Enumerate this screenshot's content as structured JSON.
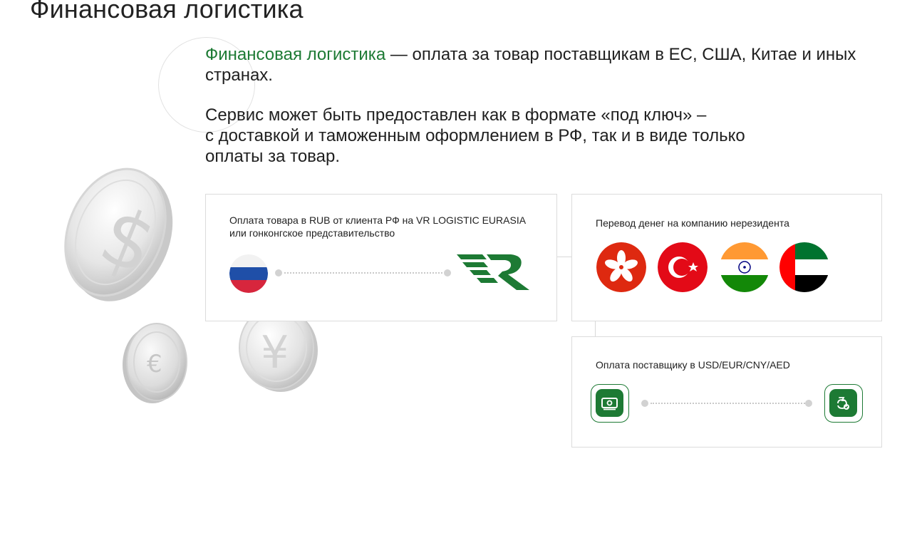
{
  "page": {
    "title": "Финансовая логистика"
  },
  "intro": {
    "highlight": "Финансовая логистика",
    "rest": " — оплата за товар поставщикам в ЕС, США, Китае и иных странах."
  },
  "description": "Сервис может быть предоставлен как в формате «под ключ» –\nс доставкой и таможенным оформлением в РФ, так и в виде только\nоплаты за товар.",
  "cards": {
    "payment_rub": {
      "text": "Оплата товара в RUB от клиента РФ на VR LOGISTIC EURASIA или гонконгское представительство"
    },
    "transfer": {
      "text": "Перевод денег на компанию нерезидента"
    },
    "supplier": {
      "text": "Оплата поставщику в USD/EUR/CNY/AED"
    }
  },
  "icons": {
    "from_flag": "russia-flag-icon",
    "to_logo": "vr-logistic-logo",
    "flags": [
      "hong-kong-flag-icon",
      "turkey-flag-icon",
      "india-flag-icon",
      "uae-flag-icon"
    ],
    "supplier_from": "cash-icon",
    "supplier_to": "money-hand-icon",
    "coins": [
      "dollar-coin",
      "euro-coin",
      "yuan-coin"
    ]
  },
  "colors": {
    "accent": "#1d7a34",
    "border": "#dcdcdc",
    "text": "#1f1f1f"
  }
}
